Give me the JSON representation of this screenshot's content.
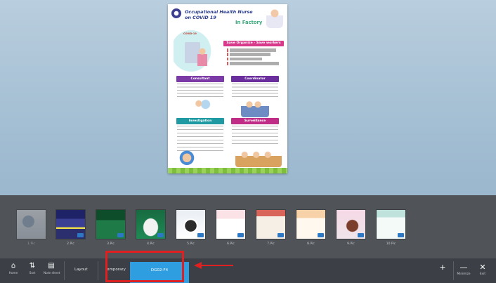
{
  "poster": {
    "title_line1": "Occupational Health Nurse",
    "title_line2": "on COVID 19",
    "subtitle": "In Factory",
    "ribbon": "Save Organize - Save workers",
    "covid_label": "COVID-19",
    "boxes": [
      "Consultant",
      "Coordinator",
      "Investigation",
      "Surveillance"
    ]
  },
  "thumbnails": [
    {
      "label": "1.Pic",
      "dim": true
    },
    {
      "label": "2.Pic"
    },
    {
      "label": "3.Pic"
    },
    {
      "label": "4.Pic"
    },
    {
      "label": "5.Pic"
    },
    {
      "label": "6.Pic"
    },
    {
      "label": "7.Pic"
    },
    {
      "label": "8.Pic"
    },
    {
      "label": "9.Pic"
    },
    {
      "label": "10.Pic"
    }
  ],
  "toolbar": {
    "home": "Home",
    "sort": "Sort",
    "note_sheet": "Note sheet",
    "layout": "Layout",
    "temporary": "temporary",
    "active_tab": "DG02-F4",
    "add": "+",
    "minimize": "Minimize",
    "exit": "Exit"
  },
  "colors": {
    "accent": "#2f9ee0",
    "annotation": "#e02020"
  }
}
